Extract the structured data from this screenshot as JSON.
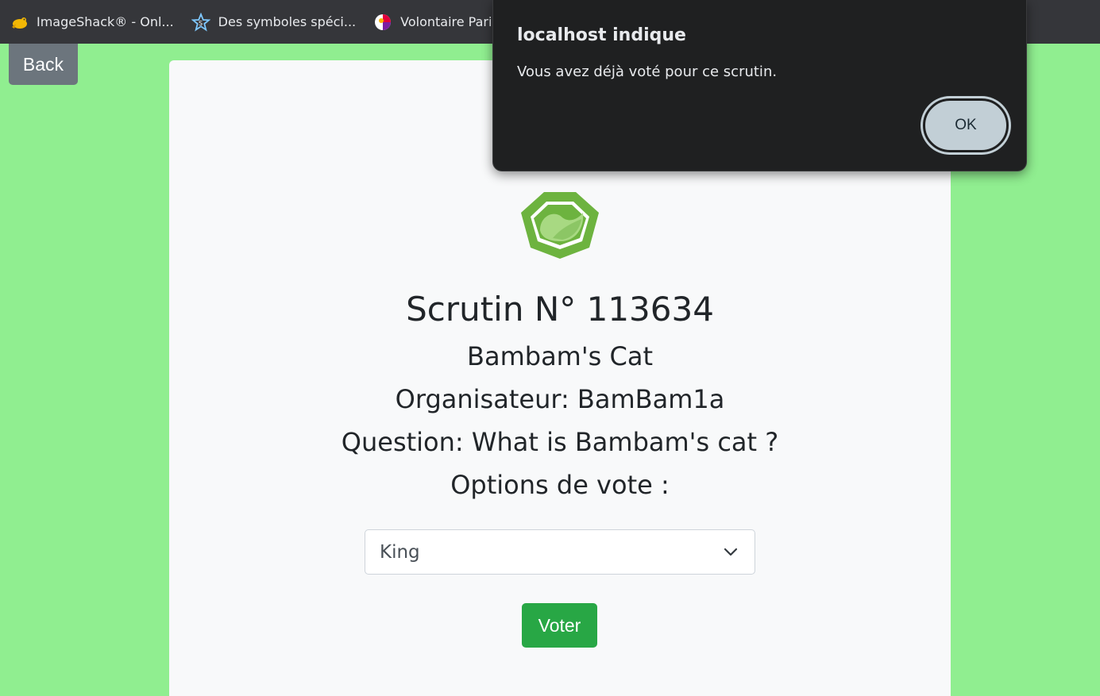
{
  "bookmarks": [
    {
      "label": "ImageShack® - Onl...",
      "icon": "imageshack-frog-icon"
    },
    {
      "label": "Des symboles spéci...",
      "icon": "star-icon"
    },
    {
      "label": "Volontaire Paris",
      "icon": "volunteer-logo-icon"
    }
  ],
  "back_label": "Back",
  "scrutin": {
    "title": "Scrutin N° 113634",
    "name": "Bambam's Cat",
    "organizer": "Organisateur: BamBam1a",
    "question": "Question: What is Bambam's cat ?",
    "options_heading": "Options de vote :"
  },
  "vote_select": {
    "selected": "King"
  },
  "vote_label": "Voter",
  "dialog": {
    "title": "localhost indique",
    "message": "Vous avez déjà voté pour ce scrutin.",
    "ok_label": "OK"
  },
  "colors": {
    "page_bg": "#90ee90",
    "logo_green": "#6db33f",
    "vote_button": "#28a745",
    "back_button": "#6c757d"
  }
}
